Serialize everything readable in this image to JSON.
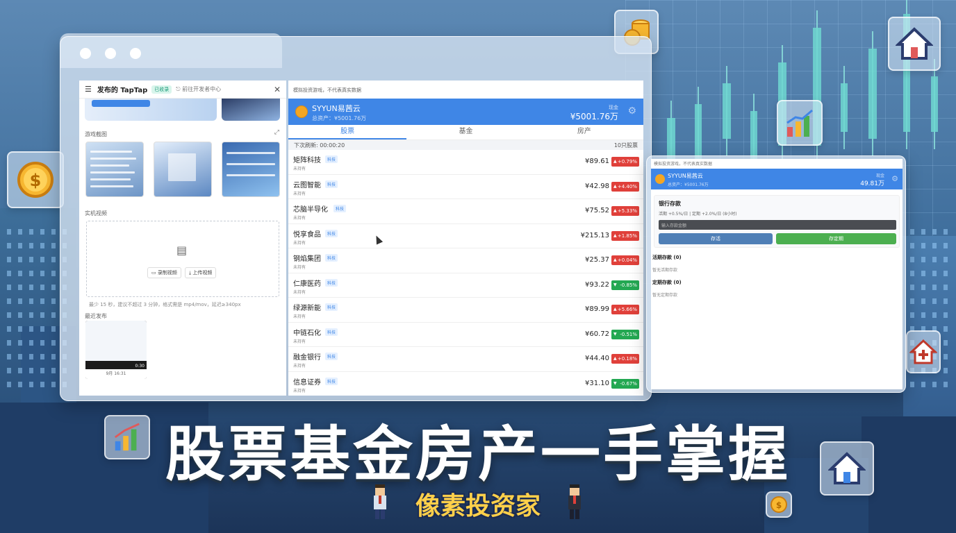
{
  "caption": "股票基金房产一手掌握",
  "logo": "像素投资家",
  "left_pane": {
    "title": "发布的 TapTap",
    "status_badge": "已收录",
    "dev_link": "前往开发者中心",
    "close": "✕",
    "section_screenshots": "游戏截图",
    "section_video": "实机视频",
    "record_btn": "录制视频",
    "upload_btn": "上传视频",
    "hint": "最少 15 秒，建议不超过 3 分钟，格式需是 mp4/mov，延迟≥340px",
    "section_latest": "最近发布",
    "thumb_duration": "0:30",
    "thumb_date": "9月 16:31"
  },
  "right_pane": {
    "top_note": "模拟投资游戏，不代表真实数据",
    "account": {
      "name": "SYYUN易茜云",
      "sub": "总资产：¥5001.76万",
      "label": "现金",
      "amount": "¥5001.76万"
    },
    "tabs": [
      "股票",
      "基金",
      "房产"
    ],
    "refresh_label": "下次刷新: 00:00:20",
    "count_label": "10只股票",
    "tag": "科技",
    "hold": "未持有",
    "stocks": [
      {
        "name": "矩阵科技",
        "price": "¥89.61",
        "change": "+0.79%",
        "dir": "up"
      },
      {
        "name": "云图智能",
        "price": "¥42.98",
        "change": "+4.40%",
        "dir": "up"
      },
      {
        "name": "芯脑半导化",
        "price": "¥75.52",
        "change": "+5.33%",
        "dir": "up"
      },
      {
        "name": "悦享食品",
        "price": "¥215.13",
        "change": "+1.85%",
        "dir": "up"
      },
      {
        "name": "钢焰集团",
        "price": "¥25.37",
        "change": "+0.04%",
        "dir": "up"
      },
      {
        "name": "仁康医药",
        "price": "¥93.22",
        "change": "-0.85%",
        "dir": "down"
      },
      {
        "name": "绿源新能",
        "price": "¥89.99",
        "change": "+5.66%",
        "dir": "up"
      },
      {
        "name": "中链石化",
        "price": "¥60.72",
        "change": "-0.51%",
        "dir": "down"
      },
      {
        "name": "融金银行",
        "price": "¥44.40",
        "change": "+0.18%",
        "dir": "up"
      },
      {
        "name": "信息证券",
        "price": "¥31.10",
        "change": "-0.67%",
        "dir": "down"
      }
    ]
  },
  "bank_window": {
    "top_note": "模拟投资游戏，不代表真实数据",
    "account_name": "SYYUN易茜云",
    "account_sub": "总资产：¥5001.76万",
    "cash_label": "现金",
    "cash_amount": "49.81万",
    "bank_title": "银行存款",
    "rates": "活期 +0.5%/日 | 定期 +2.0%/日 (8小时)",
    "input_placeholder": "输入存款金额",
    "btn_demand": "存活",
    "btn_fixed": "存定期",
    "demand_title": "活期存款 (0)",
    "demand_empty": "暂无活期存款",
    "fixed_title": "定期存款 (0)",
    "fixed_empty": "暂无定期存款"
  },
  "colors": {
    "accent": "#3f86e6",
    "up": "#e0403a",
    "down": "#23a852",
    "green_btn": "#4caf50",
    "logo_gold": "#ffd04a"
  }
}
